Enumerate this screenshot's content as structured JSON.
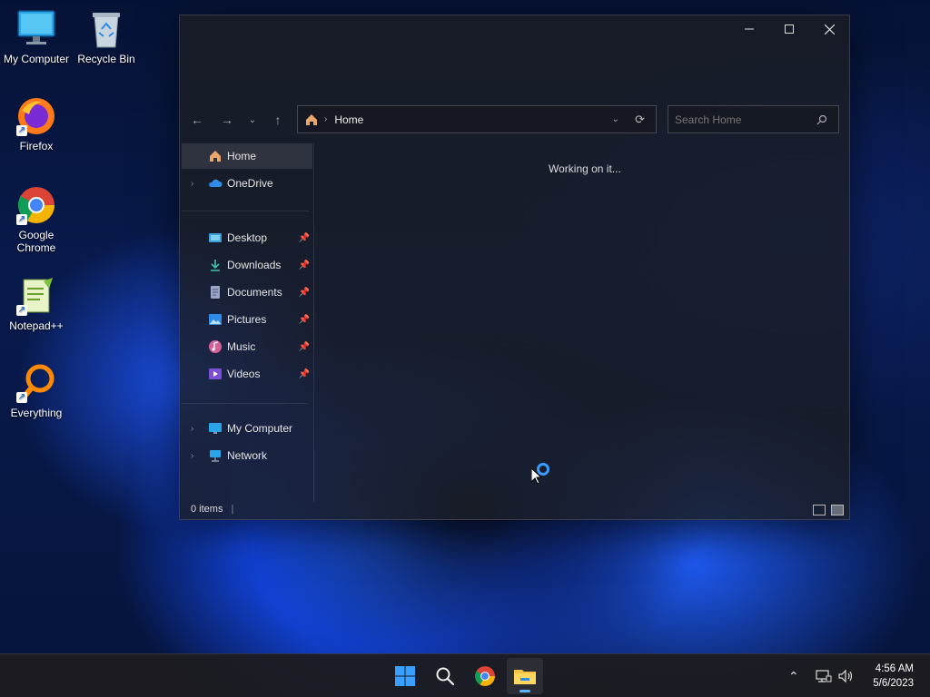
{
  "desktop": {
    "icons": [
      {
        "label": "My Computer"
      },
      {
        "label": "Recycle Bin"
      },
      {
        "label": "Firefox"
      },
      {
        "label": "Google Chrome"
      },
      {
        "label": "Notepad++"
      },
      {
        "label": "Everything"
      }
    ]
  },
  "explorer": {
    "address": {
      "crumb": "Home"
    },
    "search": {
      "placeholder": "Search Home"
    },
    "sidebar": {
      "items": [
        {
          "label": "Home"
        },
        {
          "label": "OneDrive"
        },
        {
          "label": "Desktop"
        },
        {
          "label": "Downloads"
        },
        {
          "label": "Documents"
        },
        {
          "label": "Pictures"
        },
        {
          "label": "Music"
        },
        {
          "label": "Videos"
        },
        {
          "label": "My Computer"
        },
        {
          "label": "Network"
        }
      ]
    },
    "content": {
      "status": "Working on it..."
    },
    "statusbar": {
      "items": "0 items"
    }
  },
  "taskbar": {
    "clock": {
      "time": "4:56 AM",
      "date": "5/6/2023"
    }
  },
  "colors": {
    "accent": "#60b3ff",
    "spinner": "#3b9cff",
    "window_bg": "#1c1e24",
    "taskbar_bg": "#1c1c20"
  }
}
